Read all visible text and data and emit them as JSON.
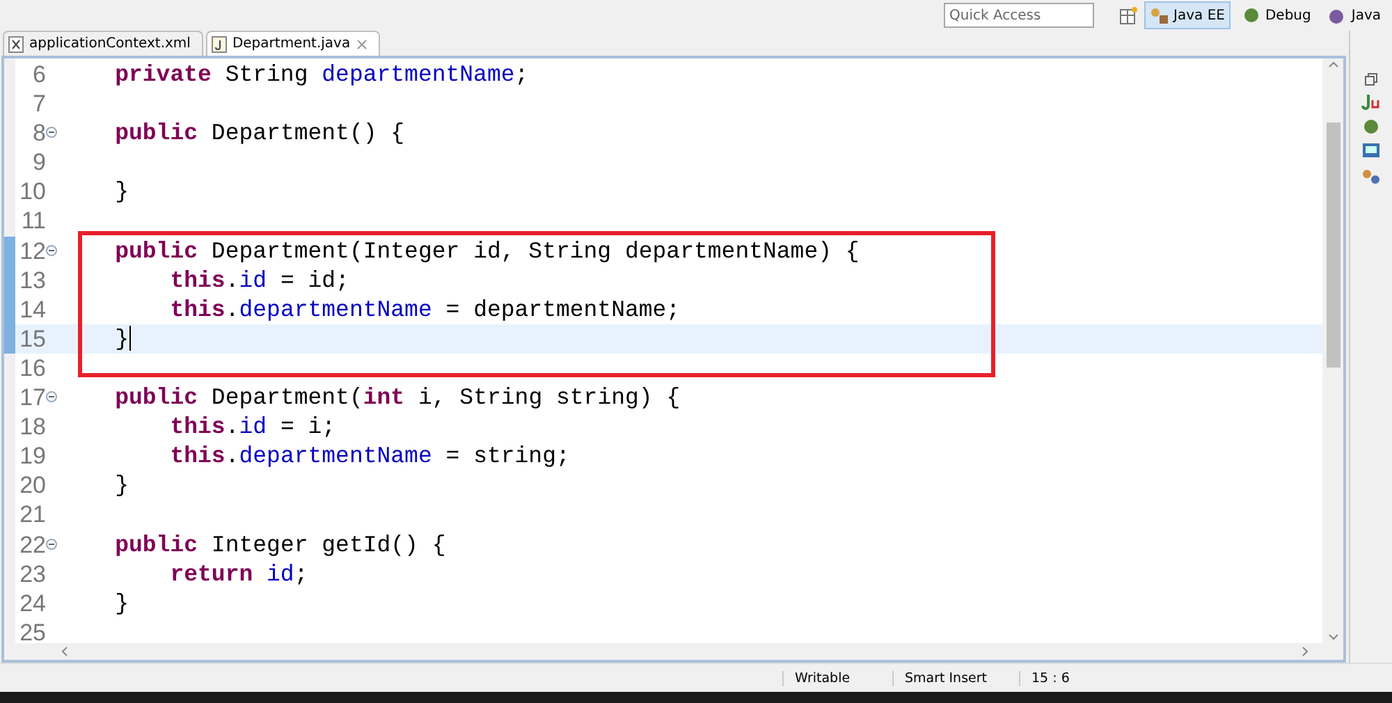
{
  "toolbar": {
    "quick_access": {
      "placeholder": "Quick Access"
    },
    "perspectives": [
      {
        "label": "Java EE",
        "kind": "javaee",
        "selected": true
      },
      {
        "label": "Debug",
        "kind": "debug",
        "selected": false
      },
      {
        "label": "Java",
        "kind": "java",
        "selected": false
      }
    ]
  },
  "tabs": [
    {
      "label": "applicationContext.xml",
      "kind": "xml",
      "selected": false
    },
    {
      "label": "Department.java",
      "kind": "java",
      "selected": true
    }
  ],
  "editor": {
    "lines": [
      {
        "number": "6",
        "foldable": false,
        "changed": false,
        "current": false,
        "boxed": false,
        "tokens": [
          {
            "kind": "keyword",
            "text": "    private"
          },
          {
            "kind": "plain",
            "text": " String "
          },
          {
            "kind": "field",
            "text": "departmentName"
          },
          {
            "kind": "plain",
            "text": ";"
          }
        ]
      },
      {
        "number": "7",
        "foldable": false,
        "changed": false,
        "current": false,
        "boxed": false
      },
      {
        "number": "8",
        "foldable": true,
        "changed": false,
        "current": false,
        "boxed": false,
        "tokens": [
          {
            "kind": "keyword",
            "text": "    public"
          },
          {
            "kind": "plain",
            "text": " Department() {"
          }
        ]
      },
      {
        "number": "9",
        "foldable": false,
        "changed": false,
        "current": false,
        "boxed": false
      },
      {
        "number": "10",
        "foldable": false,
        "changed": false,
        "current": false,
        "boxed": false,
        "tokens": [
          {
            "kind": "plain",
            "text": "    }"
          }
        ]
      },
      {
        "number": "11",
        "foldable": false,
        "changed": false,
        "current": false,
        "boxed": false
      },
      {
        "number": "12",
        "foldable": true,
        "changed": true,
        "current": false,
        "boxed": true,
        "tokens": [
          {
            "kind": "keyword",
            "text": "    public"
          },
          {
            "kind": "plain",
            "text": " Department(Integer id, String departmentName) {"
          }
        ]
      },
      {
        "number": "13",
        "foldable": false,
        "changed": true,
        "current": false,
        "boxed": true,
        "tokens": [
          {
            "kind": "keyword",
            "text": "        this"
          },
          {
            "kind": "plain",
            "text": "."
          },
          {
            "kind": "field",
            "text": "id"
          },
          {
            "kind": "plain",
            "text": " = id;"
          }
        ]
      },
      {
        "number": "14",
        "foldable": false,
        "changed": true,
        "current": false,
        "boxed": true,
        "tokens": [
          {
            "kind": "keyword",
            "text": "        this"
          },
          {
            "kind": "plain",
            "text": "."
          },
          {
            "kind": "field",
            "text": "departmentName"
          },
          {
            "kind": "plain",
            "text": " = departmentName;"
          }
        ]
      },
      {
        "number": "15",
        "foldable": false,
        "changed": true,
        "current": true,
        "boxed": true,
        "tokens": [
          {
            "kind": "plain",
            "text": "    }"
          }
        ]
      },
      {
        "number": "16",
        "foldable": false,
        "changed": false,
        "current": false,
        "boxed": true
      },
      {
        "number": "17",
        "foldable": true,
        "changed": false,
        "current": false,
        "boxed": false,
        "tokens": [
          {
            "kind": "keyword",
            "text": "    public"
          },
          {
            "kind": "plain",
            "text": " Department("
          },
          {
            "kind": "keyword",
            "text": "int"
          },
          {
            "kind": "plain",
            "text": " i, String string) {"
          }
        ]
      },
      {
        "number": "18",
        "foldable": false,
        "changed": false,
        "current": false,
        "boxed": false,
        "tokens": [
          {
            "kind": "keyword",
            "text": "        this"
          },
          {
            "kind": "plain",
            "text": "."
          },
          {
            "kind": "field",
            "text": "id"
          },
          {
            "kind": "plain",
            "text": " = i;"
          }
        ]
      },
      {
        "number": "19",
        "foldable": false,
        "changed": false,
        "current": false,
        "boxed": false,
        "tokens": [
          {
            "kind": "keyword",
            "text": "        this"
          },
          {
            "kind": "plain",
            "text": "."
          },
          {
            "kind": "field",
            "text": "departmentName"
          },
          {
            "kind": "plain",
            "text": " = string;"
          }
        ]
      },
      {
        "number": "20",
        "foldable": false,
        "changed": false,
        "current": false,
        "boxed": false,
        "tokens": [
          {
            "kind": "plain",
            "text": "    }"
          }
        ]
      },
      {
        "number": "21",
        "foldable": false,
        "changed": false,
        "current": false,
        "boxed": false
      },
      {
        "number": "22",
        "foldable": true,
        "changed": false,
        "current": false,
        "boxed": false,
        "tokens": [
          {
            "kind": "keyword",
            "text": "    public"
          },
          {
            "kind": "plain",
            "text": " Integer getId() {"
          }
        ]
      },
      {
        "number": "23",
        "foldable": false,
        "changed": false,
        "current": false,
        "boxed": false,
        "tokens": [
          {
            "kind": "keyword",
            "text": "        return"
          },
          {
            "kind": "field",
            "text": " id"
          },
          {
            "kind": "plain",
            "text": ";"
          }
        ]
      },
      {
        "number": "24",
        "foldable": false,
        "changed": false,
        "current": false,
        "boxed": false,
        "tokens": [
          {
            "kind": "plain",
            "text": "    }"
          }
        ]
      },
      {
        "number": "25",
        "foldable": false,
        "changed": false,
        "current": false,
        "boxed": false
      }
    ]
  },
  "status_bar": [
    "Writable",
    "Smart Insert",
    "15 : 6"
  ]
}
